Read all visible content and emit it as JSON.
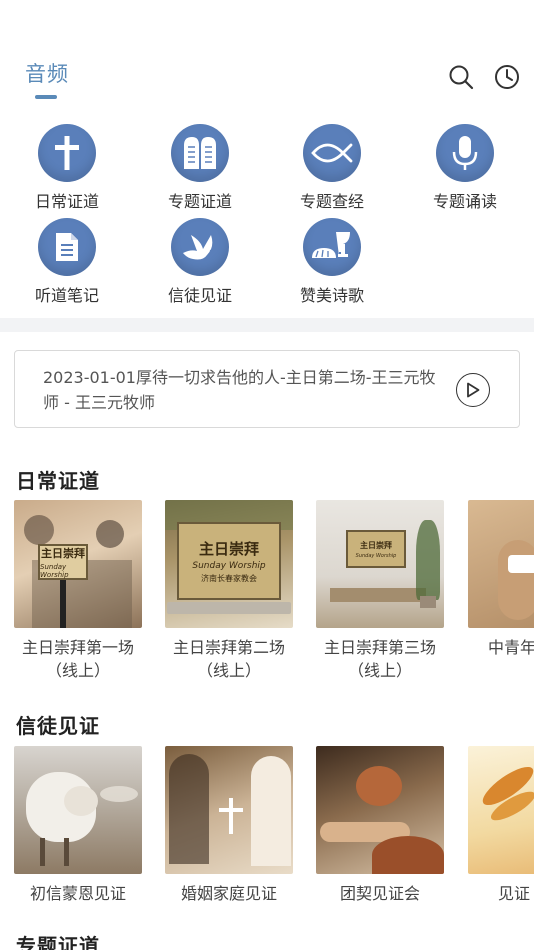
{
  "header": {
    "title": "音频",
    "search_icon": "search-icon",
    "history_icon": "clock-icon"
  },
  "categories": [
    {
      "label": "日常证道",
      "icon": "cross-icon"
    },
    {
      "label": "专题证道",
      "icon": "tablets-icon"
    },
    {
      "label": "专题查经",
      "icon": "fish-icon"
    },
    {
      "label": "专题诵读",
      "icon": "microphone-icon"
    },
    {
      "label": "听道笔记",
      "icon": "document-icon"
    },
    {
      "label": "信徒见证",
      "icon": "dove-icon"
    },
    {
      "label": "赞美诗歌",
      "icon": "bread-cup-icon"
    }
  ],
  "now_playing": {
    "text": "2023-01-01厚待一切求告他的人-主日第二场-王三元牧师 - 王三元牧师",
    "play_icon": "play-circle-icon"
  },
  "sections": [
    {
      "title": "日常证道",
      "items": [
        {
          "title": "主日崇拜第一场\n（线上）",
          "thumb_sign": "主日崇拜",
          "thumb_sub": "Sunday Worship"
        },
        {
          "title": "主日崇拜第二场\n（线上）",
          "thumb_sign": "主日崇拜",
          "thumb_sub": "Sunday Worship",
          "thumb_footer": "济南长春家教会"
        },
        {
          "title": "主日崇拜第三场\n（线上）",
          "thumb_sign": "主日崇拜",
          "thumb_sub": "Sunday Worship"
        },
        {
          "title": "中青年"
        }
      ]
    },
    {
      "title": "信徒见证",
      "items": [
        {
          "title": "初信蒙恩见证"
        },
        {
          "title": "婚姻家庭见证"
        },
        {
          "title": "团契见证会"
        },
        {
          "title": "见证"
        }
      ]
    },
    {
      "title": "专题证道"
    }
  ],
  "colors": {
    "accent": "#5a8ab8",
    "icon_circle": "#5a7fba",
    "band": "#f2f3f5"
  }
}
